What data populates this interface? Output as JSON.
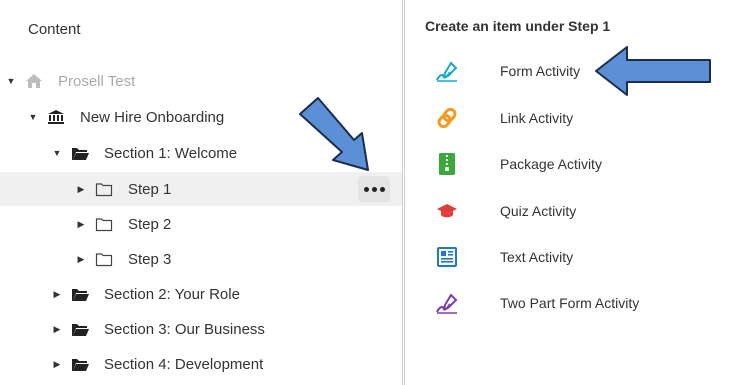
{
  "left_pane": {
    "title": "Content",
    "tree": [
      {
        "label": "Prosell Test",
        "icon": "home-icon"
      },
      {
        "label": "New Hire Onboarding",
        "icon": "bank-icon"
      },
      {
        "label": "Section 1: Welcome",
        "icon": "folder-open-icon"
      },
      {
        "label": "Step 1",
        "icon": "folder-outline-icon"
      },
      {
        "label": "Step 2",
        "icon": "folder-outline-icon"
      },
      {
        "label": "Step 3",
        "icon": "folder-outline-icon"
      },
      {
        "label": "Section 2: Your Role",
        "icon": "folder-open-icon"
      },
      {
        "label": "Section 3: Our Business",
        "icon": "folder-open-icon"
      },
      {
        "label": "Section 4: Development",
        "icon": "folder-open-icon"
      }
    ],
    "selected_item": "Step 1",
    "more_button_icon": "more-horizontal-icon"
  },
  "right_pane": {
    "title": "Create an item under Step 1",
    "activities": [
      {
        "label": "Form Activity",
        "icon": "form-edit-icon",
        "color": "#17a9cc"
      },
      {
        "label": "Link Activity",
        "icon": "link-icon",
        "color": "#f29a1f"
      },
      {
        "label": "Package Activity",
        "icon": "zip-package-icon",
        "color": "#3aa83a"
      },
      {
        "label": "Quiz Activity",
        "icon": "graduation-cap-icon",
        "color": "#e23b3b"
      },
      {
        "label": "Text Activity",
        "icon": "text-document-icon",
        "color": "#1f78c8"
      },
      {
        "label": "Two Part Form Activity",
        "icon": "two-part-form-icon",
        "color": "#7a3fb0"
      }
    ]
  },
  "colors": {
    "selected_row_bg": "#f0f0f0",
    "arrow_fill": "#5b8fd6",
    "divider": "#cfcfcf"
  }
}
